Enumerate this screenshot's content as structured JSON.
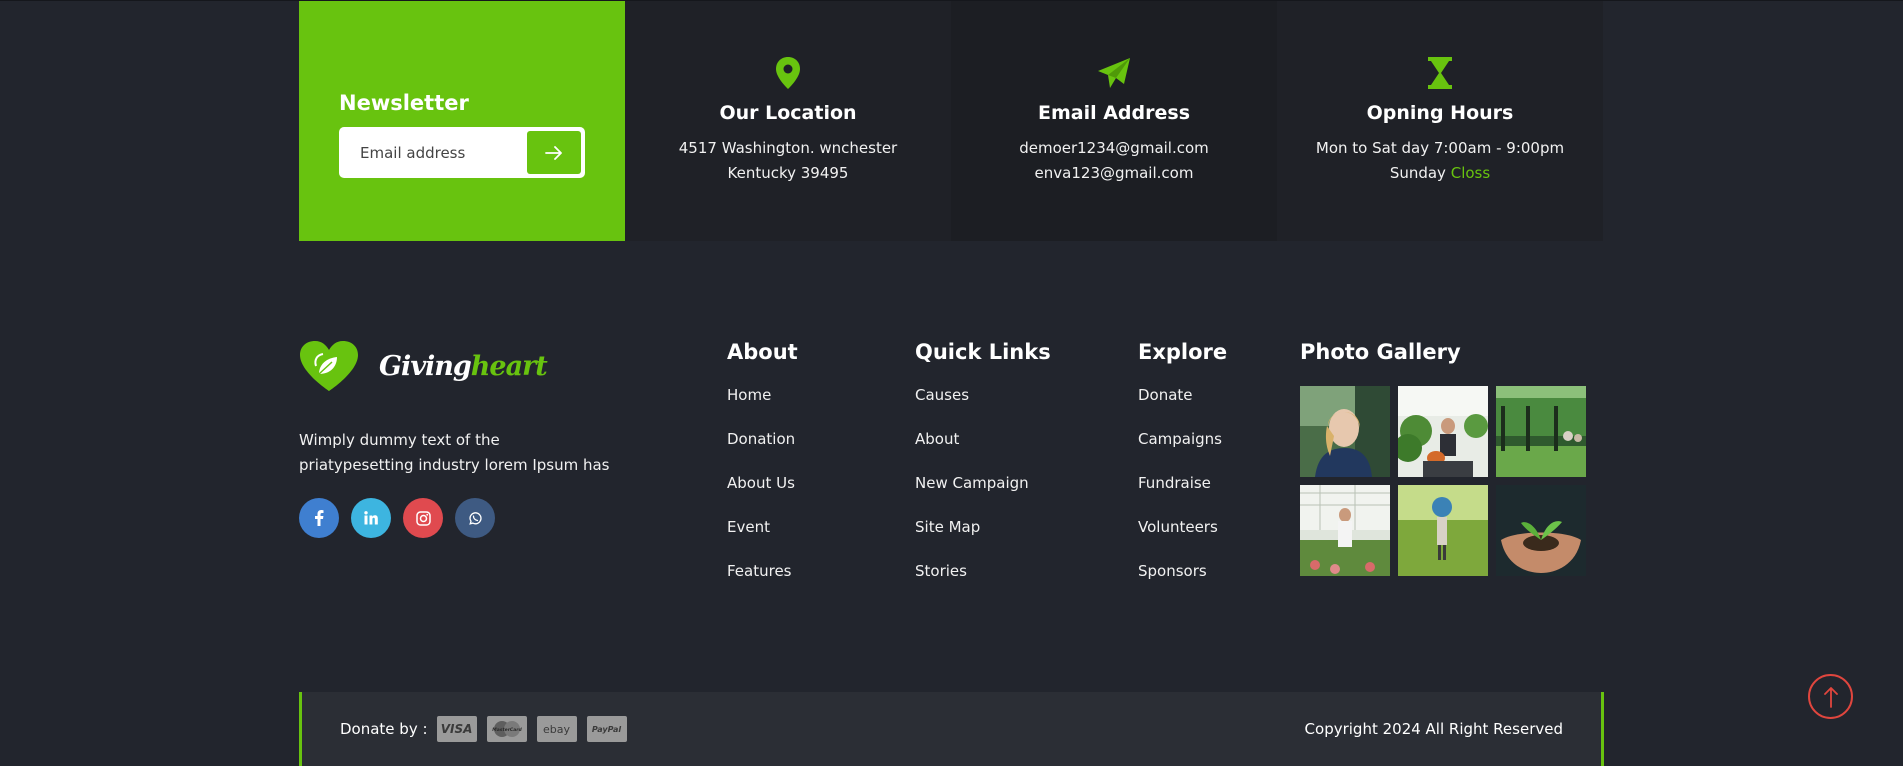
{
  "newsletter": {
    "title": "Newsletter",
    "email_placeholder": "Email address"
  },
  "info_cards": [
    {
      "icon": "map-pin-icon",
      "title": "Our Location",
      "line1": "4517 Washington. wnchester",
      "line2": "Kentucky 39495"
    },
    {
      "icon": "paper-plane-icon",
      "title": "Email Address",
      "line1": "demoer1234@gmail.com",
      "line2": "enva123@gmail.com"
    },
    {
      "icon": "hourglass-icon",
      "title": "Opning Hours",
      "line1": "Mon to Sat day 7:00am - 9:00pm",
      "line2_prefix": "Sunday",
      "line2_status": "Closs"
    }
  ],
  "brand": {
    "name_part1": "Giving",
    "name_part2": "heart",
    "description": "Wimply dummy text of the priatypesetting industry lorem Ipsum has",
    "socials": [
      "facebook-icon",
      "linkedin-icon",
      "instagram-icon",
      "whatsapp-icon"
    ]
  },
  "columns": {
    "about": {
      "title": "About",
      "links": [
        "Home",
        "Donation",
        "About Us",
        "Event",
        "Features"
      ]
    },
    "quick_links": {
      "title": "Quick Links",
      "links": [
        "Causes",
        "About",
        "New Campaign",
        "Site Map",
        "Stories"
      ]
    },
    "explore": {
      "title": "Explore",
      "links": [
        "Donate",
        "Campaigns",
        "Fundraise",
        "Volunteers",
        "Sponsors"
      ]
    },
    "gallery": {
      "title": "Photo Gallery"
    }
  },
  "bottom": {
    "donate_label": "Donate by :",
    "payments": [
      "VISA",
      "MasterCard",
      "ebay",
      "PayPal"
    ],
    "copyright": "Copyright 2024 All Right Reserved"
  },
  "colors": {
    "accent": "#68c30f",
    "background": "#22252d",
    "to_top": "#e0463e"
  }
}
